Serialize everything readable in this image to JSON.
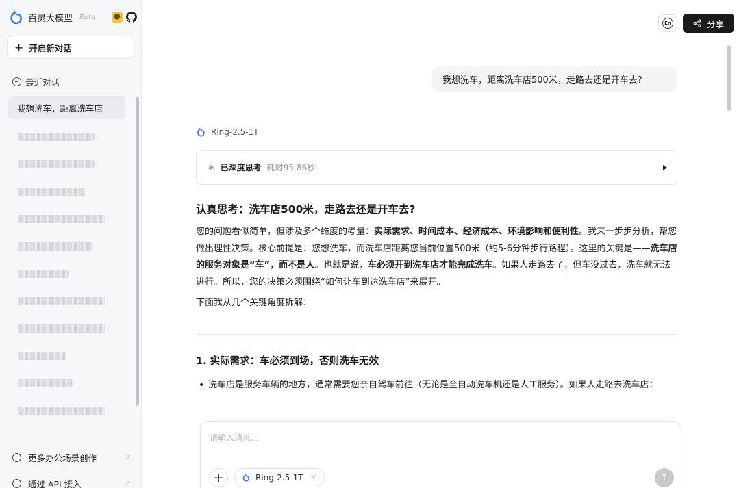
{
  "brand": {
    "name": "百灵大模型",
    "beta": "Beta",
    "emoji_icon": "smiley-badge-icon",
    "github_icon": "github-icon"
  },
  "sidebar": {
    "new_chat_label": "开启新对话",
    "recent_label": "最近对话",
    "active_history": "我想洗车，距离洗车店",
    "blurred_items_count": 11,
    "footer": [
      {
        "label": "更多办公场景创作",
        "icon": "smile-icon"
      },
      {
        "label": "通过 API 接入",
        "icon": "api-icon"
      }
    ]
  },
  "topbar": {
    "lang_label": "En",
    "share_label": "分享"
  },
  "chat": {
    "user_message": "我想洗车，距离洗车店500米，走路去还是开车去?",
    "model_name": "Ring-2.5-1T",
    "thinking": {
      "status": "已深度思考",
      "duration": "耗时95.86秒"
    },
    "answer_title": "认真思考：洗车店500米，走路去还是开车去?",
    "para1_a": "您的问题看似简单，但涉及多个维度的考量：",
    "para1_b": "实际需求、时间成本、经济成本、环境影响和便利性",
    "para1_c": "。我来一步步分析，帮您做出理性决策。核心前提是：您想洗车，而洗车店距离您当前位置500米（约5-6分钟步行路程）。这里的关键是——",
    "para1_d": "洗车店的服务对象是“车”，而不是人",
    "para1_e": "。也就是说，",
    "para1_f": "车必须开到洗车店才能完成洗车",
    "para1_g": "。如果人走路去了，但车没过去，洗车就无法进行。所以，您的决策必须围绕“如何让车到达洗车店”来展开。",
    "para2": "下面我从几个关键角度拆解：",
    "section1_title": "1. 实际需求：车必须到场，否则洗车无效",
    "bullet1": "洗车店是服务车辆的地方，通常需要您亲自驾车前往（无论是全自动洗车机还是人工服务）。如果人走路去洗车店："
  },
  "composer": {
    "placeholder": "请输入消息...",
    "model_label": "Ring-2.5-1T"
  },
  "colors": {
    "share_bg": "#1a1a1a",
    "sidebar_bg": "#f6f7f9",
    "brand_blue": "#3b7bf0",
    "user_bubble": "#f3f4f6"
  }
}
